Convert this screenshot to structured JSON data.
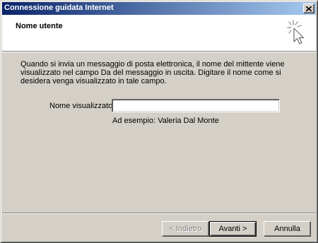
{
  "window": {
    "title": "Connessione guidata Internet",
    "close_icon": "close-icon"
  },
  "header": {
    "title": "Nome utente",
    "icon": "wizard-cursor-icon"
  },
  "body": {
    "description": "Quando si invia un messaggio di posta elettronica, il nome del mittente viene visualizzato nel campo Da del messaggio in uscita. Digitare il nome come si desidera venga visualizzato in tale campo.",
    "field_label": "Nome visualizzato:",
    "field_value": "",
    "example": "Ad esempio: Valeria Dal Monte"
  },
  "buttons": {
    "back": "< Indietro",
    "next": "Avanti >",
    "cancel": "Annulla"
  },
  "colors": {
    "titlebar_start": "#0a246a",
    "titlebar_end": "#a6caf0",
    "face": "#d4d0c8"
  }
}
